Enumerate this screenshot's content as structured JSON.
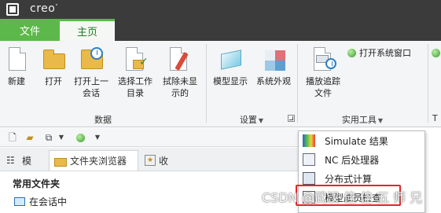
{
  "app": {
    "name": "creo",
    "trademark": "°"
  },
  "tabs": {
    "file": "文件",
    "home": "主页"
  },
  "ribbon": {
    "buttons": {
      "new": "新建",
      "open": "打开",
      "open_last_line1": "打开上一",
      "open_last_line2": "会话",
      "select_dir_line1": "选择工作",
      "select_dir_line2": "目录",
      "erase_line1": "拭除未显",
      "erase_line2": "示的",
      "model_display": "模型显示",
      "system_appearance": "系统外观",
      "playback_line1": "播放追踪",
      "playback_line2": "文件",
      "open_system_window": "打开系统窗口"
    },
    "groups": {
      "data": "数据",
      "settings": "设置",
      "utilities": "实用工具",
      "truncated": "T"
    }
  },
  "navigator": {
    "tabs": {
      "model": "模",
      "folder_browser": "文件夹浏览器",
      "favorites": "收"
    },
    "tree_title": "常用文件夹",
    "tree_items": [
      "在会话中"
    ]
  },
  "utilities_menu": {
    "items": [
      "Simulate 结果",
      "NC 后处理器",
      "分布式计算",
      "模型成员检查"
    ]
  },
  "watermark": "CSDN @武汉 佳 佳 五 师 兄",
  "colors": {
    "title_bar": "#3b3b3b",
    "accent_green": "#5cb84a",
    "highlight_red": "#e32626"
  }
}
